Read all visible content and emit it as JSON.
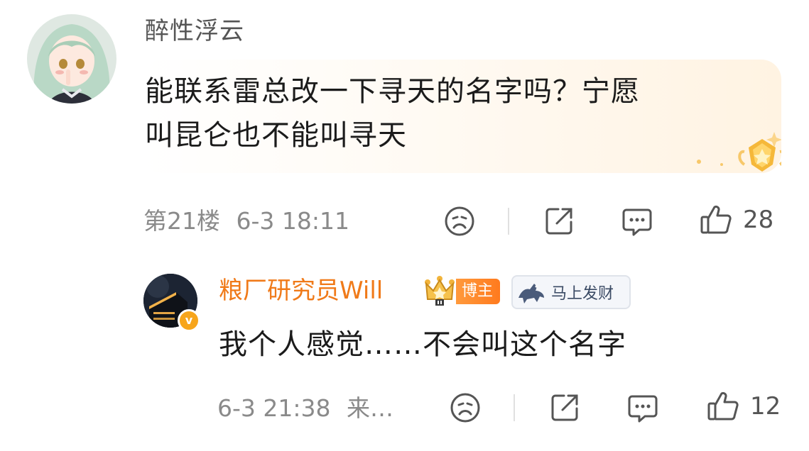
{
  "comment": {
    "username": "醉性浮云",
    "text_line1": "能联系雷总改一下寻天的名字吗？宁愿",
    "text_line2": "叫昆仑也不能叫寻天",
    "floor": "第21楼",
    "time": "6-3 18:11",
    "like_count": "28",
    "icons": [
      "sad-face-icon",
      "share-icon",
      "comment-icon",
      "thumbs-up-icon"
    ],
    "badge_color": "#f5b83a"
  },
  "reply": {
    "username": "粮厂研究员Will",
    "role_badge": "博主",
    "fortune_badge": "马上发财",
    "text": "我个人感觉……不会叫这个名字",
    "time": "6-3 21:38",
    "source": "来…",
    "like_count": "12",
    "verified_badge_letter": "v",
    "username_color": "#f07a19"
  }
}
